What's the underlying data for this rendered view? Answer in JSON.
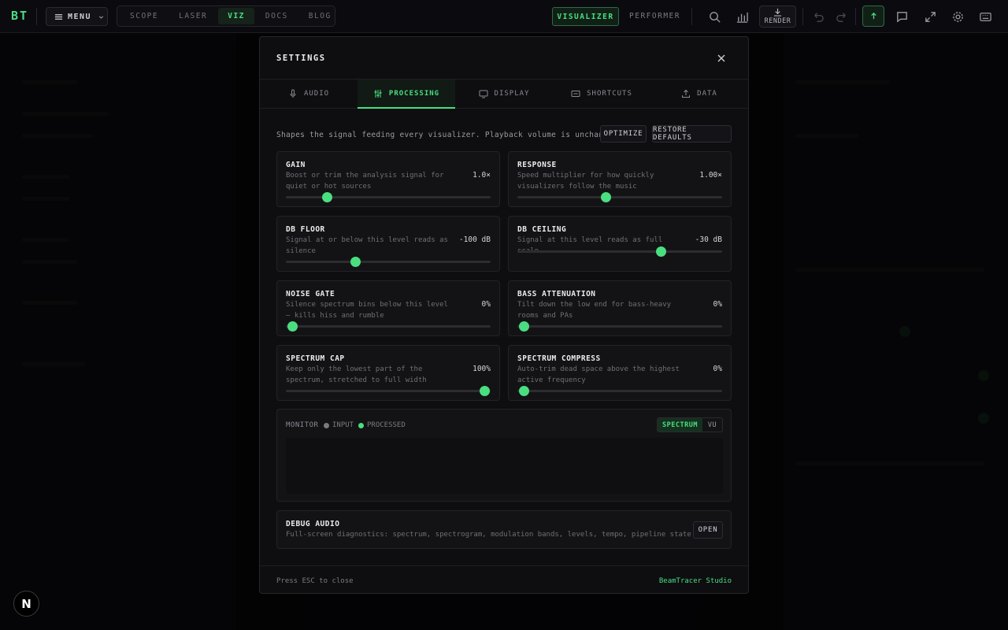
{
  "app": {
    "logo": "BT"
  },
  "topbar": {
    "menu_label": "MENU",
    "nav": [
      "SCOPE",
      "LASER",
      "VIZ",
      "DOCS",
      "BLOG"
    ],
    "nav_active": "VIZ",
    "modes": [
      "VISUALIZER",
      "PERFORMER"
    ],
    "render_label": "RENDER"
  },
  "settings": {
    "title": "SETTINGS",
    "tabs": [
      {
        "label": "AUDIO",
        "icon": "mic-icon"
      },
      {
        "label": "PROCESSING",
        "icon": "sliders-icon",
        "active": true
      },
      {
        "label": "DISPLAY",
        "icon": "monitor-icon"
      },
      {
        "label": "SHORTCUTS",
        "icon": "keyboard-icon"
      },
      {
        "label": "DATA",
        "icon": "upload-icon"
      }
    ],
    "intro": "Shapes the signal feeding every visualizer. Playback volume is unchanged.",
    "optimize_label": "OPTIMIZE",
    "restore_label": "RESTORE DEFAULTS",
    "controls": [
      {
        "title": "GAIN",
        "desc": "Boost or trim the analysis signal for quiet or hot sources",
        "value": "1.0×",
        "fraction": 0.2
      },
      {
        "title": "RESPONSE",
        "desc": "Speed multiplier for how quickly visualizers follow the music",
        "value": "1.00×",
        "fraction": 0.43
      },
      {
        "title": "DB FLOOR",
        "desc": "Signal at or below this level reads as silence",
        "value": "-100 dB",
        "fraction": 0.34
      },
      {
        "title": "DB CEILING",
        "desc": "Signal at this level reads as full scale",
        "value": "-30 dB",
        "fraction": 0.7
      },
      {
        "title": "NOISE GATE",
        "desc": "Silence spectrum bins below this level — kills hiss and rumble",
        "value": "0%",
        "fraction": 0.03
      },
      {
        "title": "BASS ATTENUATION",
        "desc": "Tilt down the low end for bass-heavy rooms and PAs",
        "value": "0%",
        "fraction": 0.03
      },
      {
        "title": "SPECTRUM CAP",
        "desc": "Keep only the lowest part of the spectrum, stretched to full width",
        "value": "100%",
        "fraction": 0.97
      },
      {
        "title": "SPECTRUM COMPRESS",
        "desc": "Auto-trim dead space above the highest active frequency",
        "value": "0%",
        "fraction": 0.03
      }
    ],
    "monitor": {
      "label": "MONITOR",
      "legend": [
        {
          "label": "INPUT",
          "color": "#7a7a80"
        },
        {
          "label": "PROCESSED",
          "color": "#4ade80"
        }
      ],
      "views": [
        "SPECTRUM",
        "VU"
      ],
      "active_view": "SPECTRUM"
    },
    "debug": {
      "title": "DEBUG AUDIO",
      "desc": "Full-screen diagnostics: spectrum, spectrogram, modulation bands, levels, tempo, pipeline state",
      "open_label": "OPEN"
    },
    "footer_hint": "Press ESC to close",
    "footer_brand": "BeamTracer Studio"
  },
  "colors": {
    "accent": "#4ade80",
    "background": "#07070a",
    "panel": "#0e0e11"
  },
  "badge": {
    "letter": "N"
  }
}
